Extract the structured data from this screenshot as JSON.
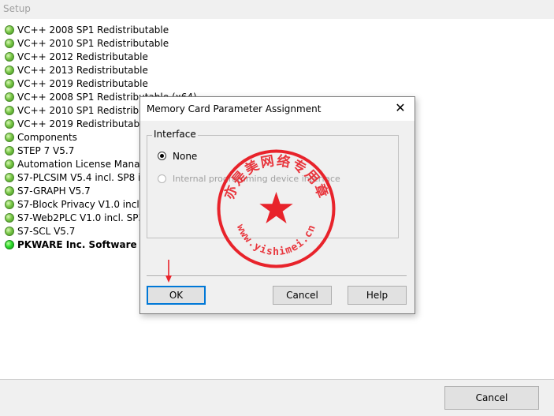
{
  "window": {
    "title": "Setup"
  },
  "components": [
    {
      "label": "VC++ 2008 SP1 Redistributable",
      "bold": false
    },
    {
      "label": "VC++ 2010 SP1 Redistributable",
      "bold": false
    },
    {
      "label": "VC++ 2012 Redistributable",
      "bold": false
    },
    {
      "label": "VC++ 2013 Redistributable",
      "bold": false
    },
    {
      "label": "VC++ 2019 Redistributable",
      "bold": false
    },
    {
      "label": "VC++ 2008 SP1 Redistributable (x64)",
      "bold": false
    },
    {
      "label": "VC++ 2010 SP1 Redistributable (x64)",
      "bold": false
    },
    {
      "label": "VC++ 2019 Redistributable (x64)",
      "bold": false
    },
    {
      "label": "Components",
      "bold": false
    },
    {
      "label": "STEP 7  V5.7",
      "bold": false
    },
    {
      "label": "Automation License Manager",
      "bold": false
    },
    {
      "label": "S7-PLCSIM V5.4 incl. SP8 incl. Upd",
      "bold": false
    },
    {
      "label": "S7-GRAPH  V5.7",
      "bold": false
    },
    {
      "label": "S7-Block Privacy V1.0 incl. SP1",
      "bold": false
    },
    {
      "label": "S7-Web2PLC V1.0 incl. SP3",
      "bold": false
    },
    {
      "label": "S7-SCL V5.7",
      "bold": false
    },
    {
      "label": "PKWARE Inc. Software",
      "bold": true
    }
  ],
  "footer": {
    "cancel_label": "Cancel"
  },
  "dialog": {
    "title": "Memory Card Parameter Assignment",
    "close_glyph": "✕",
    "group_label": "Interface",
    "options": [
      {
        "label": "None",
        "checked": true,
        "enabled": true
      },
      {
        "label": "Internal programming device interface",
        "checked": false,
        "enabled": false
      }
    ],
    "ok_label": "OK",
    "cancel_label": "Cancel",
    "help_label": "Help"
  },
  "seal": {
    "top_text": "亦是美网络专用章",
    "bottom_text": "www.yishimei.cn",
    "color": "#e8232b"
  },
  "colors": {
    "focus_border": "#0078d7",
    "status_dot": "#4caf30",
    "annotation_arrow": "#e8232b"
  }
}
